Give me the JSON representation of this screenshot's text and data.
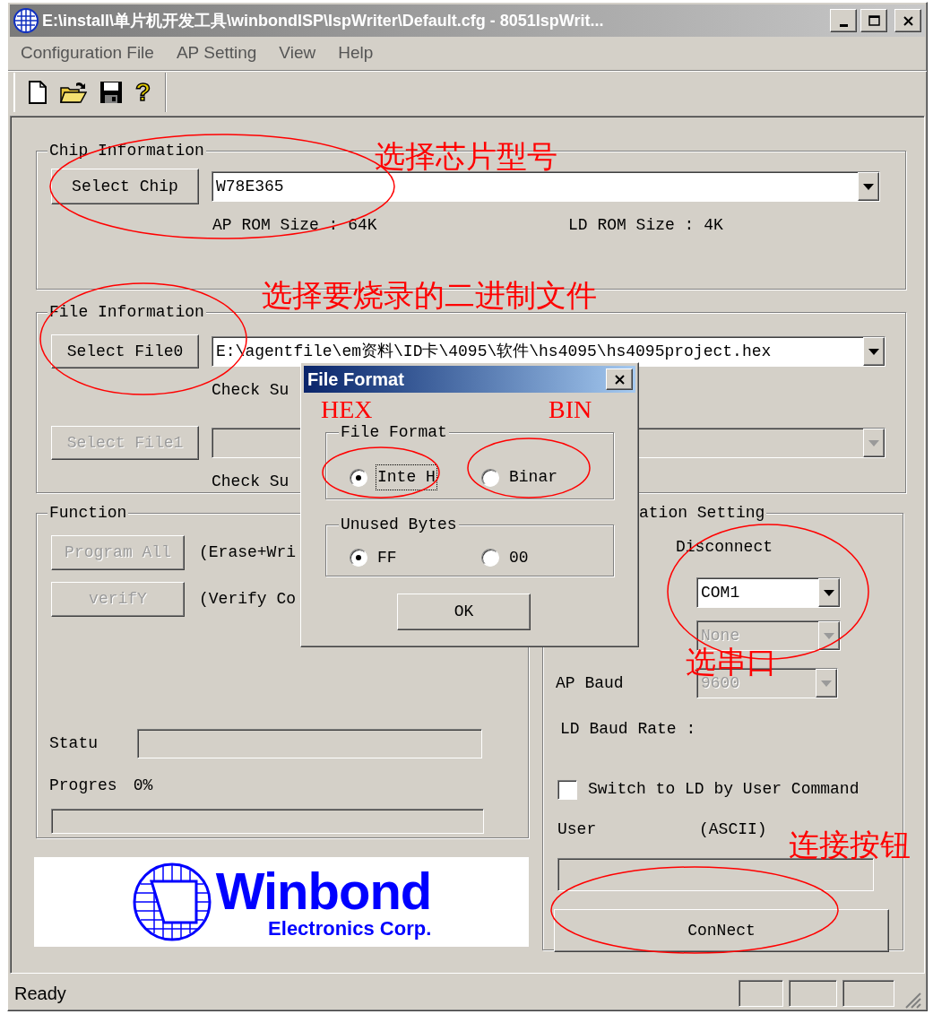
{
  "window": {
    "title": "E:\\install\\单片机开发工具\\winbondISP\\IspWriter\\Default.cfg - 8051IspWrit..."
  },
  "menu": [
    {
      "label": "Configuration File"
    },
    {
      "label": "AP Setting"
    },
    {
      "label": "View"
    },
    {
      "label": "Help"
    }
  ],
  "toolbar": [
    {
      "kind": "new"
    },
    {
      "kind": "open"
    },
    {
      "kind": "save"
    },
    {
      "kind": "help",
      "text": "?"
    }
  ],
  "chip_information": {
    "title": "Chip Information",
    "button": "Select Chip",
    "chip": "W78E365",
    "ap_rom_size": "AP ROM Size : 64K",
    "ld_rom_size": "LD ROM Size : 4K"
  },
  "file_information": {
    "title": "File Information",
    "files": [
      {
        "button": "Select File0",
        "disabled": false,
        "path": "E:\\agentfile\\em资料\\ID卡\\4095\\软件\\hs4095\\hs4095project.hex",
        "check_sum": "Check Su"
      },
      {
        "button": "Select File1",
        "disabled": true,
        "check_sum": "Check Su"
      }
    ]
  },
  "function": {
    "title": "Function",
    "actions": [
      {
        "button": "Program All",
        "disabled": true,
        "description": "(Erase+Wri"
      },
      {
        "button": "verifY",
        "disabled": true,
        "description": "(Verify Co"
      }
    ],
    "status_label": "Statu",
    "progress_label": "Progres",
    "progress_value": "0%",
    "progress": {
      "level": 0
    }
  },
  "logo": {
    "name": "Winbond",
    "tagline": "Electronics Corp."
  },
  "communication": {
    "title": "ation Setting",
    "state": "Disconnect",
    "port": {
      "value": "COM1",
      "disabled": false
    },
    "parity": {
      "value": "None",
      "disabled": true
    },
    "ap_baud": {
      "label": "AP Baud",
      "value": "9600",
      "disabled": true
    },
    "ld_baud_rate": "LD Baud Rate :",
    "switch": {
      "label": "Switch to LD by User Command",
      "checked": false
    },
    "user_command": {
      "label": "User",
      "hint": "(ASCII)"
    },
    "button": "ConNect"
  },
  "dialog": {
    "title": "File Format",
    "groups": [
      {
        "title": "File Format",
        "options": [
          {
            "label": "Inte H",
            "selected": true,
            "focused": true
          },
          {
            "label": "Binar",
            "selected": false,
            "focused": false
          }
        ]
      },
      {
        "title": "Unused Bytes",
        "options": [
          {
            "label": "FF",
            "selected": true,
            "focused": false
          },
          {
            "label": "00",
            "selected": false,
            "focused": false
          }
        ]
      }
    ],
    "button": "OK"
  },
  "status_bar": {
    "text": "Ready"
  },
  "annotations": [
    {
      "text": "选择芯片型号"
    },
    {
      "text": "选择要烧录的二进制文件"
    },
    {
      "text": "HEX"
    },
    {
      "text": "BIN"
    },
    {
      "text": "选串口"
    },
    {
      "text": "连接按钮"
    }
  ]
}
